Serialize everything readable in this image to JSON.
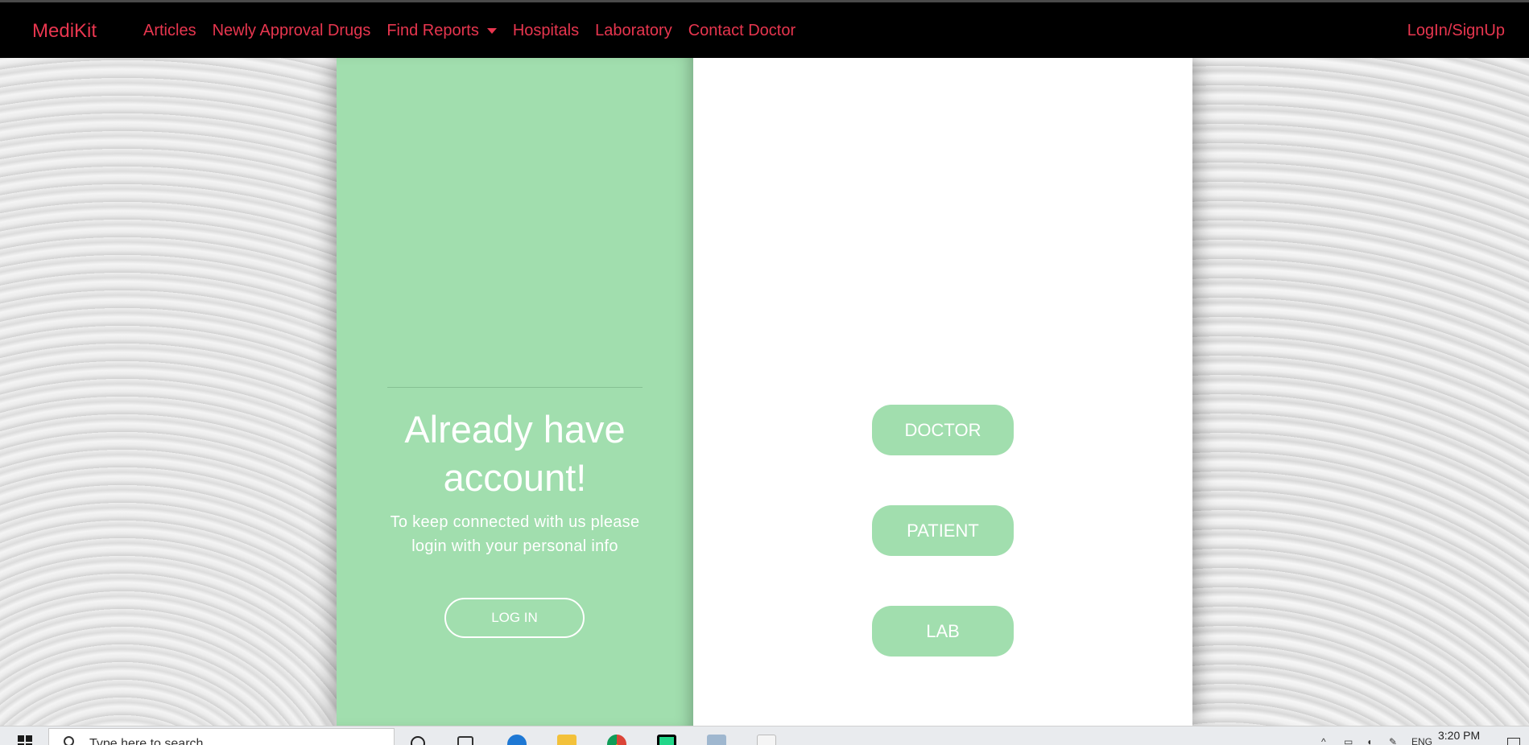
{
  "navbar": {
    "brand": "MediKit",
    "links": [
      {
        "label": "Articles"
      },
      {
        "label": "Newly Approval Drugs"
      },
      {
        "label": "Find Reports"
      },
      {
        "label": "Hospitals"
      },
      {
        "label": "Laboratory"
      },
      {
        "label": "Contact Doctor"
      }
    ],
    "login_signup": "LogIn/SignUp"
  },
  "left_panel": {
    "heading_line1": "Already have",
    "heading_line2": "account!",
    "subtext": "To keep connected with us please login with your personal info",
    "login_button": "LOG IN"
  },
  "right_panel": {
    "roles": [
      "DOCTOR",
      "PATIENT",
      "LAB"
    ]
  },
  "taskbar": {
    "search_placeholder": "Type here to search",
    "language": "ENG",
    "time": "3:20 PM"
  },
  "colors": {
    "accent": "#e8364f",
    "green": "#a1deae",
    "navbar_bg": "#000000"
  }
}
